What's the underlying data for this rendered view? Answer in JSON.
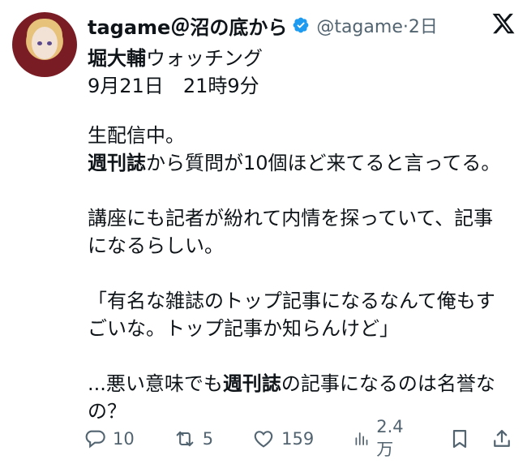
{
  "post": {
    "author_name": "tagame＠沼の底から",
    "handle": "@tagame",
    "age": "2日",
    "subtitle_bold": "堀大輔",
    "subtitle_rest": "ウォッチング",
    "date": "9月21日",
    "time": "21時9分",
    "lines": {
      "l1": "生配信中。",
      "l2_bold": "週刊誌",
      "l2_rest": "から質問が10個ほど来てると言ってる。",
      "l3": "講座にも記者が紛れて内情を探っていて、記事",
      "l4": "になるらしい。",
      "l5": "「有名な雑誌のトップ記事になるなんて俺もす",
      "l6": "ごいな。トップ記事か知らんけど」",
      "l7_pre": "...悪い意味でも",
      "l7_bold": "週刊誌",
      "l7_rest": "の記事になるのは名誉な",
      "l8": "の？"
    }
  },
  "actions": {
    "replies": "10",
    "reposts": "5",
    "likes": "159",
    "views": "2.4万"
  },
  "colors": {
    "text": "#0f1419",
    "muted": "#536471",
    "verified": "#1d9bf0"
  },
  "icons": [
    "verified-badge-icon",
    "x-logo-icon",
    "reply-icon",
    "repost-icon",
    "like-icon",
    "views-icon",
    "bookmark-icon",
    "share-icon"
  ]
}
